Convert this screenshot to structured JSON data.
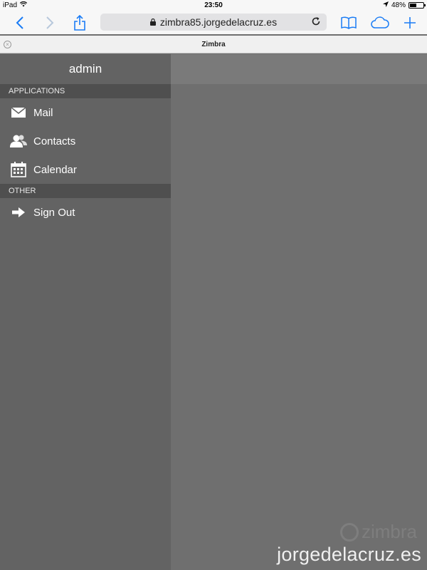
{
  "status": {
    "device": "iPad",
    "time": "23:50",
    "battery_text": "48%",
    "battery_level": 0.48
  },
  "browser": {
    "url": "zimbra85.jorgedelacruz.es",
    "tab_title": "Zimbra"
  },
  "sidebar": {
    "user": "admin",
    "sections": [
      {
        "label": "APPLICATIONS",
        "items": [
          {
            "label": "Mail",
            "icon": "mail-icon"
          },
          {
            "label": "Contacts",
            "icon": "contacts-icon"
          },
          {
            "label": "Calendar",
            "icon": "calendar-icon"
          }
        ]
      },
      {
        "label": "OTHER",
        "items": [
          {
            "label": "Sign Out",
            "icon": "arrow-right-icon"
          }
        ]
      }
    ]
  },
  "watermark": {
    "logo": "zimbra",
    "text": "jorgedelacruz.es"
  },
  "colors": {
    "accent": "#1a7cf5",
    "sidebar": "#636363",
    "section": "#4f4f4f",
    "main": "#6f6f6f"
  }
}
